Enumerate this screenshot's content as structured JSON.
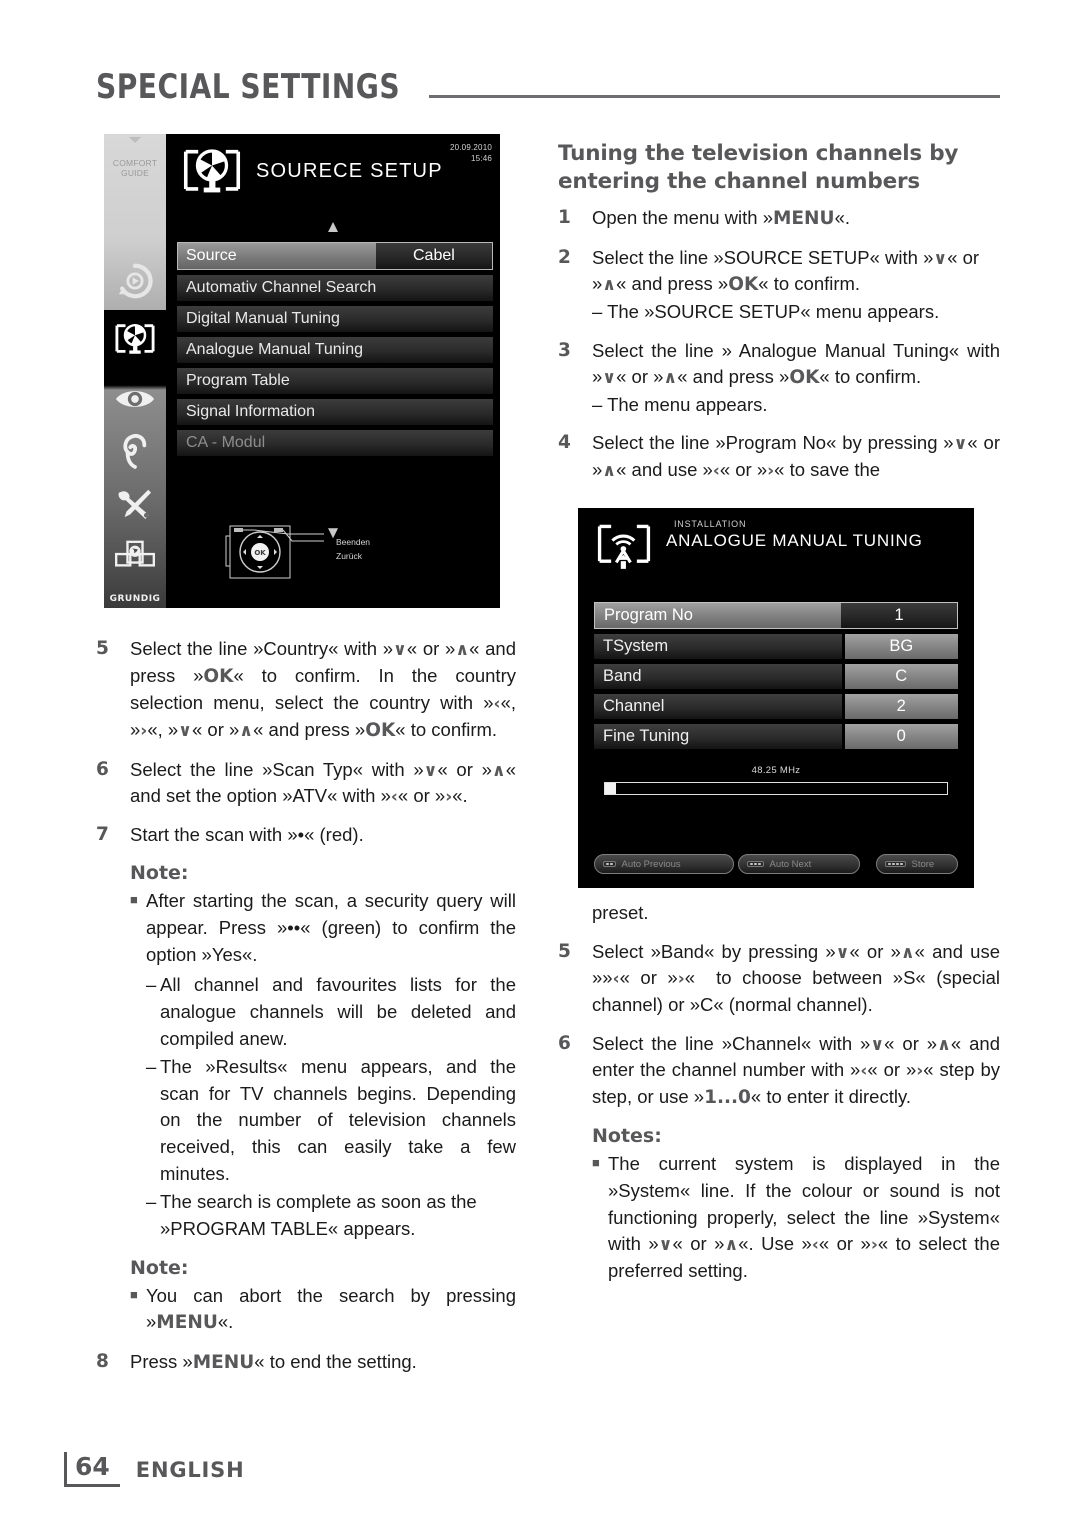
{
  "header": {
    "title": "SPECIAL SETTINGS"
  },
  "footer": {
    "page_number": "64",
    "language": "ENGLISH"
  },
  "tv_source_setup": {
    "sidebar_label_line1": "COMFORT",
    "sidebar_label_line2": "GUIDE",
    "brand": "GRUNDIG",
    "title": "SOURECE SETUP",
    "date": "20.09.2010",
    "time": "15:46",
    "menu": [
      {
        "label": "Source",
        "value": "Cabel",
        "state": "selected"
      },
      {
        "label": "Automativ Channel Search",
        "value": "",
        "state": "normal"
      },
      {
        "label": "Digital Manual Tuning",
        "value": "",
        "state": "normal"
      },
      {
        "label": "Analogue Manual Tuning",
        "value": "",
        "state": "normal"
      },
      {
        "label": "Program Table",
        "value": "",
        "state": "normal"
      },
      {
        "label": "Signal Information",
        "value": "",
        "state": "normal"
      },
      {
        "label": "CA - Modul",
        "value": "",
        "state": "disabled"
      }
    ],
    "remote_hints": [
      "Beenden",
      "Zurück"
    ],
    "ok_label": "OK"
  },
  "tv_analogue_manual_tuning": {
    "subtitle": "INSTALLATION",
    "title": "ANALOGUE MANUAL TUNING",
    "rows": [
      {
        "label": "Program No",
        "value": "1",
        "state": "selected"
      },
      {
        "label": "TSystem",
        "value": "BG",
        "state": "normal"
      },
      {
        "label": "Band",
        "value": "C",
        "state": "normal"
      },
      {
        "label": "Channel",
        "value": "2",
        "state": "normal"
      },
      {
        "label": "Fine Tuning",
        "value": "0",
        "state": "normal"
      }
    ],
    "frequency": "48.25 MHz",
    "buttons": [
      {
        "label": "Auto Previous",
        "dots": 2
      },
      {
        "label": "Auto Next",
        "dots": 3
      },
      {
        "label": "Store",
        "dots": 4
      }
    ]
  },
  "right_column": {
    "heading": "Tuning the television channels by entering the channel numbers",
    "steps": [
      {
        "num": "1",
        "text_html": "Open the menu with »<b class=\"k\">MENU</b>«."
      },
      {
        "num": "2",
        "text_html": "Select the line »SOURCE SETUP« with »<span class=\"ar\">∨</span>« or »<span class=\"ar\">∧</span>« and press »<b class=\"k\">OK</b>« to confirm.<span class=\"sub\">– The »SOURCE SETUP« menu appears.</span>"
      },
      {
        "num": "3",
        "text_html": "Select the line » Analogue Manual Tuning« with »<span class=\"ar\">∨</span>« or »<span class=\"ar\">∧</span>« and press »<b class=\"k\">OK</b>« to confirm.<span class=\"sub\">– The menu appears.</span>"
      },
      {
        "num": "4",
        "text_html": "Select the line »Program No« by pressing »<span class=\"ar\">∨</span>« or »<span class=\"ar\">∧</span>« and use »<span class=\"ar\">‹</span>« or »<span class=\"ar\">›</span>« to save the"
      }
    ],
    "continuation": "preset.",
    "steps2": [
      {
        "num": "5",
        "text_html": "Select »Band« by pressing »<span class=\"ar\">∨</span>« or »<span class=\"ar\">∧</span>« and use »»<span class=\"ar\">‹</span>« or »<span class=\"ar\">›</span>«&nbsp; to choose between »S« (special channel) or »C« (normal channel)."
      },
      {
        "num": "6",
        "text_html": "Select the line »Channel« with »<span class=\"ar\">∨</span>« or »<span class=\"ar\">∧</span>« and enter the channel number with »<span class=\"ar\">‹</span>« or »<span class=\"ar\">›</span>« step by step, or use »<b class=\"k\">1...0</b>« to enter it directly."
      }
    ],
    "notes_title": "Notes:",
    "notes": [
      "The current system is displayed in the »System« line. If the colour or sound is not functioning properly, select the line »System« with »<span class=\"ar\">∨</span>« or »<span class=\"ar\">∧</span>«. Use »<span class=\"ar\">‹</span>« or »<span class=\"ar\">›</span>« to select the preferred setting."
    ]
  },
  "left_column": {
    "steps": [
      {
        "num": "5",
        "text_html": "Select the line »Country« with »<span class=\"ar\">∨</span>« or »<span class=\"ar\">∧</span>« and press »<b class=\"k\">OK</b>« to confirm. In the country selection menu, select the country with »<span class=\"ar\">‹</span>«, »<span class=\"ar\">›</span>«, »<span class=\"ar\">∨</span>« or »<span class=\"ar\">∧</span>« and press »<b class=\"k\">OK</b>« to confirm."
      },
      {
        "num": "6",
        "text_html": "Select the line »Scan Typ« with »<span class=\"ar\">∨</span>« or »<span class=\"ar\">∧</span>« and set the option »ATV« with »<span class=\"ar\">‹</span>« or »<span class=\"ar\">›</span>«."
      },
      {
        "num": "7",
        "text_html": "Start the scan with »•« (red)."
      }
    ],
    "note1_title": "Note:",
    "note1_bullet": "After starting the scan, a security query will appear. Press »••« (green) to confirm the option »Yes«.",
    "note1_dashes": [
      "All channel and favourites lists for the analogue channels will be deleted and compiled anew.",
      "The »Results« menu appears, and the scan for TV channels begins. Depending on the number of television channels received, this can easily take a few minutes.",
      "The search is complete as soon as the »PROGRAM TABLE« appears."
    ],
    "note2_title": "Note:",
    "note2_bullet": "You can abort the search by pressing »<b class=\"k\">MENU</b>«.",
    "step8": {
      "num": "8",
      "text_html": "Press »<b class=\"k\">MENU</b>« to end the setting."
    }
  }
}
